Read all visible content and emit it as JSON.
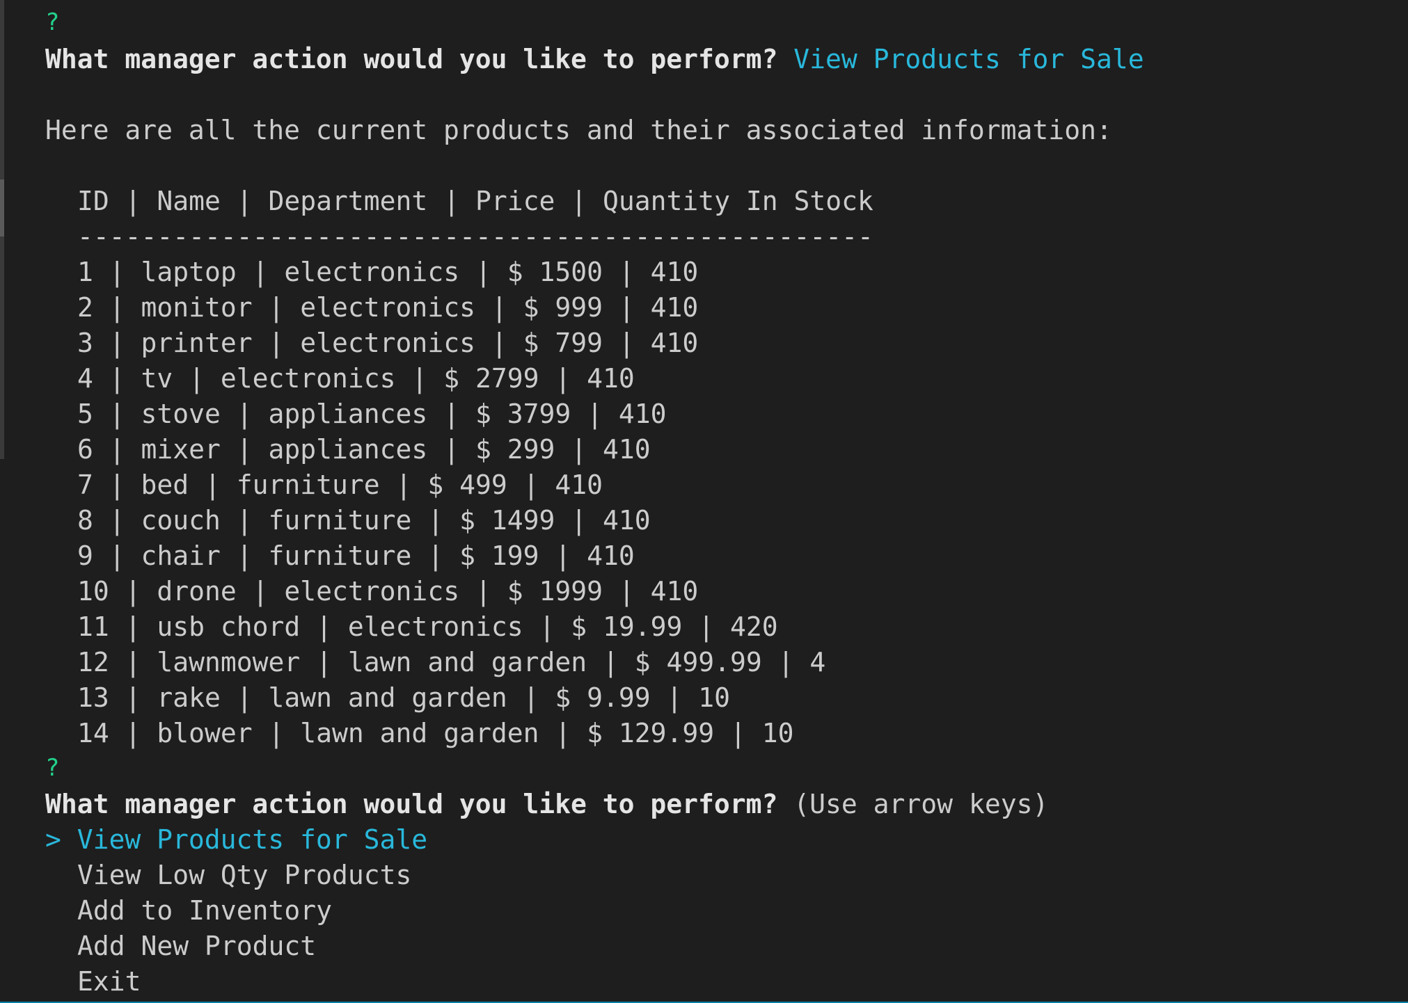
{
  "prompt_mark": "?",
  "question": "What manager action would you like to perform?",
  "first_answer": "View Products for Sale",
  "intro_text": "Here are all the current products and their associated information:",
  "table_header": "ID | Name | Department | Price | Quantity In Stock",
  "table_separator": "--------------------------------------------------",
  "rows": [
    "1 | laptop | electronics | $ 1500 | 410",
    "2 | monitor | electronics | $ 999 | 410",
    "3 | printer | electronics | $ 799 | 410",
    "4 | tv | electronics | $ 2799 | 410",
    "5 | stove | appliances | $ 3799 | 410",
    "6 | mixer | appliances | $ 299 | 410",
    "7 | bed | furniture | $ 499 | 410",
    "8 | couch | furniture | $ 1499 | 410",
    "9 | chair | furniture | $ 199 | 410",
    "10 | drone | electronics | $ 1999 | 410",
    "11 | usb chord | electronics | $ 19.99 | 420",
    "12 | lawnmower | lawn and garden | $ 499.99 | 4",
    "13 | rake | lawn and garden | $ 9.99 | 10",
    "14 | blower | lawn and garden | $ 129.99 | 10"
  ],
  "hint": "(Use arrow keys)",
  "pointer": "> ",
  "menu": [
    "View Products for Sale",
    "View Low Qty Products",
    "Add to Inventory",
    "Add New Product",
    "Exit"
  ],
  "colors": {
    "background": "#1e1e1e",
    "text": "#cccccc",
    "accent": "#29b8db",
    "prompt_mark": "#23d18b"
  }
}
